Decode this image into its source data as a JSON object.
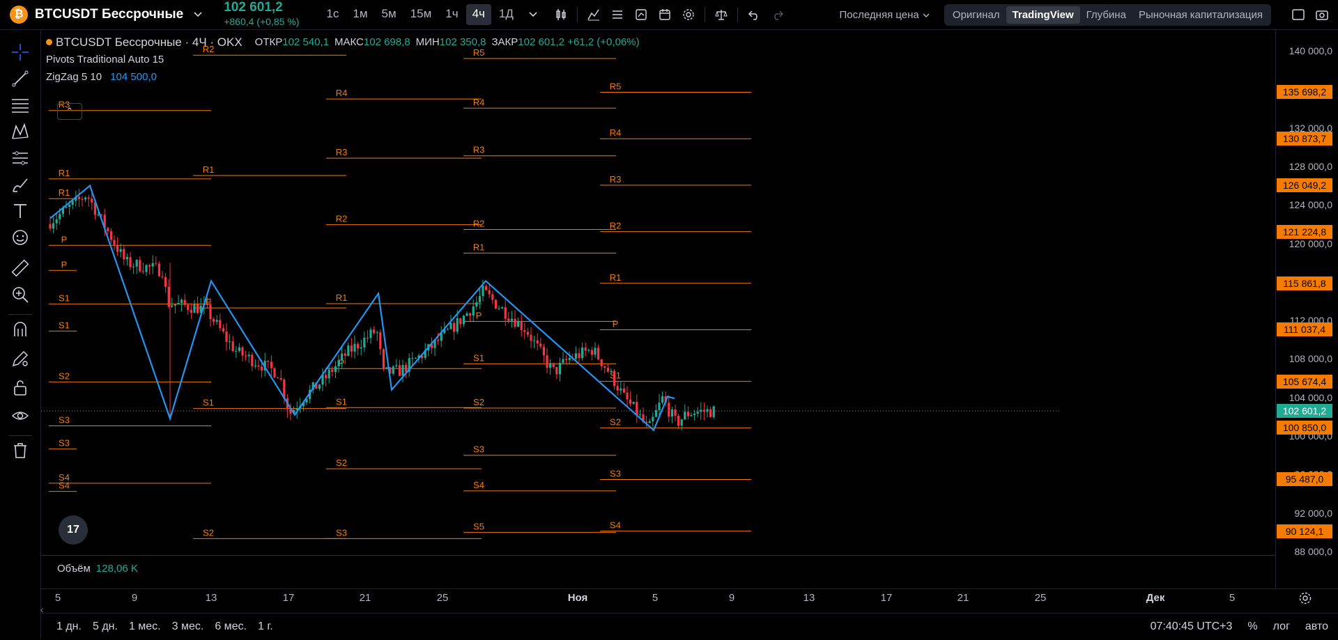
{
  "header": {
    "symbol_icon": "₿",
    "symbol": "BTCUSDT Бессрочные",
    "price": "102 601,2",
    "change": "+860,4 (+0,85 %)",
    "intervals": [
      "1с",
      "1м",
      "5м",
      "15м",
      "1ч",
      "4ч",
      "1Д"
    ],
    "price_type": "Последняя цена",
    "views": [
      "Оригинал",
      "TradingView",
      "Глубина",
      "Рыночная капитализация"
    ]
  },
  "legend": {
    "title": "BTCUSDT Бессрочные · 4Ч · OKX",
    "open_k": "ОТКР",
    "open_v": "102 540,1",
    "high_k": "МАКС",
    "high_v": "102 698,8",
    "low_k": "МИН",
    "low_v": "102 350,8",
    "close_k": "ЗАКР",
    "close_v": "102 601,2 +61,2 (+0,06%)",
    "pivots": "Pivots Traditional Auto 15",
    "zigzag": "ZigZag 5 10",
    "zigzag_v": "104 500,0",
    "collapse": "⌃"
  },
  "volume": {
    "label": "Объём",
    "value": "128,06 K"
  },
  "tv_logo": "17",
  "bottom": {
    "ranges": [
      "1 дн.",
      "5 дн.",
      "1 мес.",
      "3 мес.",
      "6 мес.",
      "1 г."
    ],
    "time": "07:40:45 UTC+3",
    "percent": "%",
    "log": "лог",
    "auto": "авто"
  },
  "y_axis": [
    "140 000,0",
    "132 000,0",
    "128 000,0",
    "124 000,0",
    "120 000,0",
    "112 000,0",
    "108 000,0",
    "104 000,0",
    "100 000,0",
    "96 000,0",
    "92 000,0",
    "88 000,0"
  ],
  "y_badges": [
    {
      "text": "135 698,2",
      "price": 135698.2,
      "color": "#f57c00"
    },
    {
      "text": "130 873,7",
      "price": 130873.7,
      "color": "#f57c00"
    },
    {
      "text": "126 049,2",
      "price": 126049.2,
      "color": "#f57c00"
    },
    {
      "text": "121 224,8",
      "price": 121224.8,
      "color": "#f57c00"
    },
    {
      "text": "115 861,8",
      "price": 115861.8,
      "color": "#f57c00"
    },
    {
      "text": "111 037,4",
      "price": 111037.4,
      "color": "#f57c00"
    },
    {
      "text": "105 674,4",
      "price": 105674.4,
      "color": "#f57c00"
    },
    {
      "text": "102 601,2",
      "price": 102601.2,
      "color": "#22ab94"
    },
    {
      "text": "100 850,0",
      "price": 100850.0,
      "color": "#f57c00"
    },
    {
      "text": "95 487,0",
      "price": 95487.0,
      "color": "#f57c00"
    },
    {
      "text": "90 124,1",
      "price": 90124.1,
      "color": "#f57c00"
    }
  ],
  "x_axis": [
    "5",
    "9",
    "13",
    "17",
    "21",
    "25",
    "Ноя",
    "5",
    "9",
    "13",
    "17",
    "21",
    "25",
    "Дек",
    "5"
  ],
  "pivot_labels": [
    "R5",
    "R4",
    "R3",
    "R2",
    "R1",
    "P",
    "S1",
    "S2",
    "S3",
    "S4",
    "S5"
  ],
  "colors": {
    "up": "#22ab94",
    "down": "#f23645",
    "pivot": "#f57c00",
    "zigzag": "#2196f3",
    "bg": "#000000"
  }
}
